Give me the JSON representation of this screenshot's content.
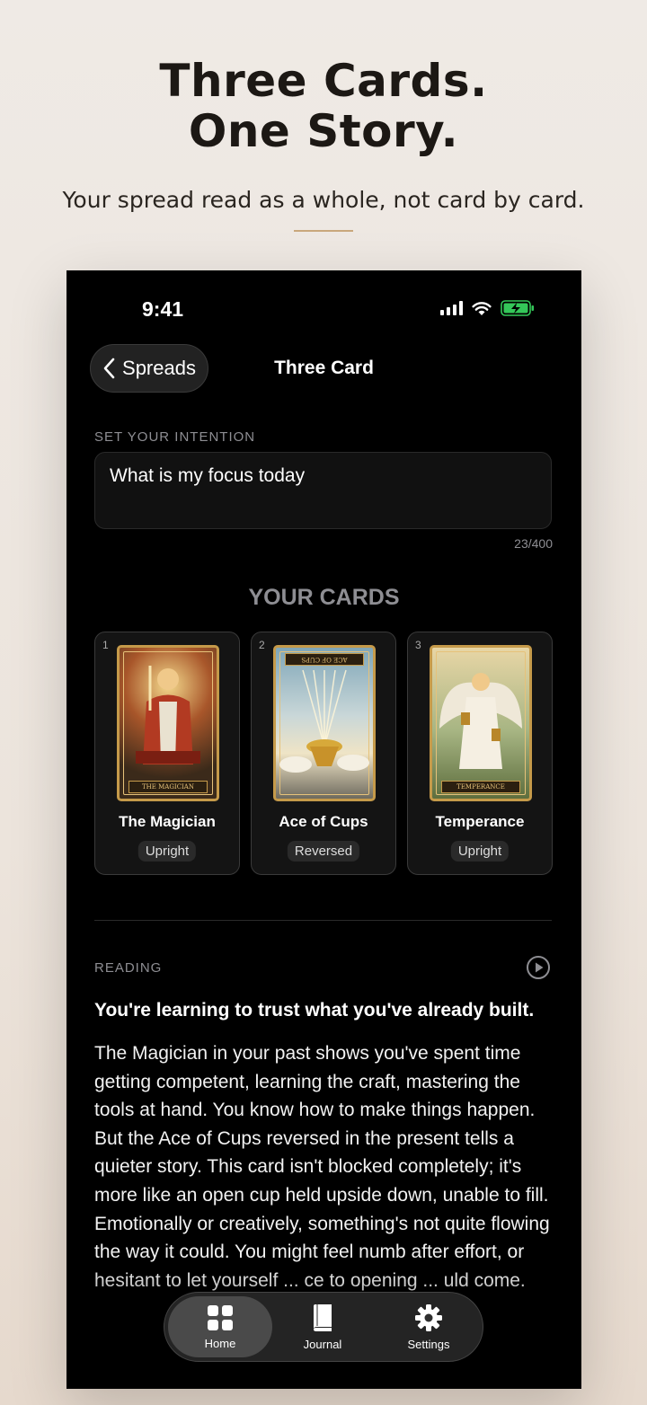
{
  "hero": {
    "title_line1": "Three Cards.",
    "title_line2": "One Story.",
    "subtitle": "Your spread read as a whole, not card by card."
  },
  "status_bar": {
    "time": "9:41"
  },
  "nav": {
    "back_label": "Spreads",
    "title": "Three Card"
  },
  "intention": {
    "label": "SET YOUR INTENTION",
    "value": "What is my focus today",
    "counter": "23/400"
  },
  "cards_section": {
    "title": "YOUR CARDS",
    "cards": [
      {
        "number": "1",
        "name": "The Magician",
        "orientation": "Upright",
        "plate": "THE MAGICIAN"
      },
      {
        "number": "2",
        "name": "Ace of Cups",
        "orientation": "Reversed",
        "plate": "ACE OF CUPS"
      },
      {
        "number": "3",
        "name": "Temperance",
        "orientation": "Upright",
        "plate": "TEMPERANCE"
      }
    ]
  },
  "reading": {
    "label": "READING",
    "headline": "You're learning to trust what you've already built.",
    "body": "The Magician in your past shows you've spent time getting competent, learning the craft, mastering the tools at hand. You know how to make things happen. But the Ace of Cups reversed in the present tells a quieter story. This card isn't blocked completely; it's more like an open cup held upside down, unable to fill. Emotionally or creatively, something's not quite flowing the way it could. You might feel numb after effort, or hesitant to let yourself ... ce to opening ... uld come."
  },
  "tabbar": {
    "tabs": [
      {
        "label": "Home",
        "icon": "grid-icon",
        "active": true
      },
      {
        "label": "Journal",
        "icon": "book-icon",
        "active": false
      },
      {
        "label": "Settings",
        "icon": "gear-icon",
        "active": false
      }
    ]
  },
  "colors": {
    "accent_gold": "#c9a77c",
    "battery_green": "#34c759"
  }
}
